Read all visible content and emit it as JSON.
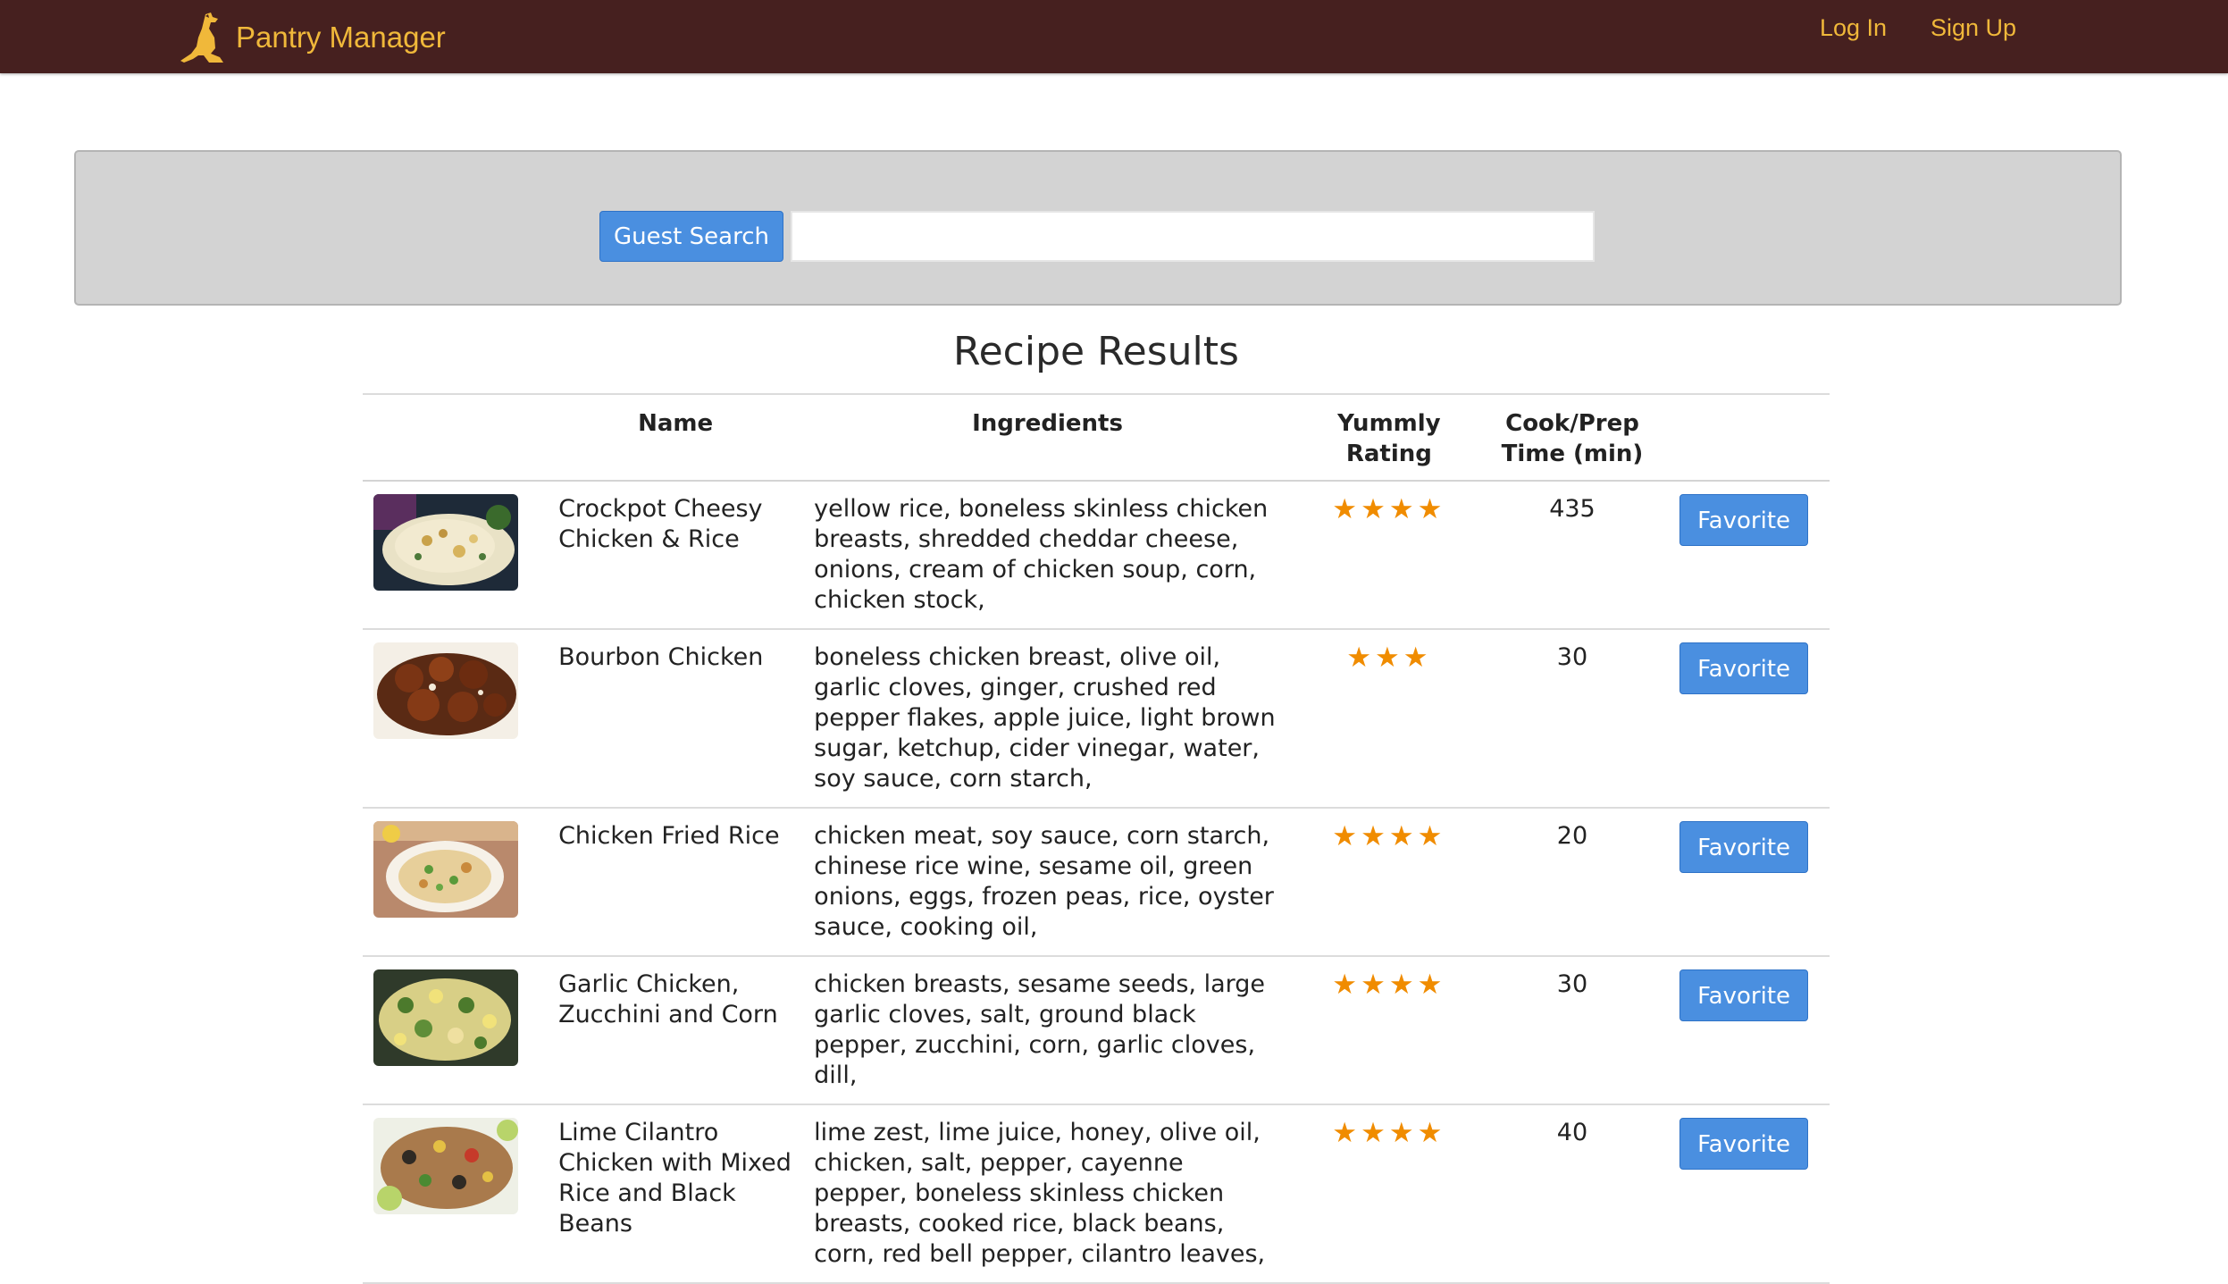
{
  "navbar": {
    "brand": "Pantry Manager",
    "brand_icon": "kangaroo-logo-icon",
    "links": {
      "login": "Log In",
      "signup": "Sign Up"
    },
    "colors": {
      "background": "#46201f",
      "text": "#f0b83a"
    }
  },
  "search": {
    "button_label": "Guest Search",
    "input_value": "",
    "input_placeholder": ""
  },
  "results": {
    "title": "Recipe Results",
    "columns": {
      "name": "Name",
      "ingredients": "Ingredients",
      "rating": "Yummly Rating",
      "time": "Cook/Prep Time (min)"
    },
    "rows": [
      {
        "name": "Crockpot Cheesy Chicken & Rice",
        "ingredients": "yellow rice, boneless skinless chicken breasts, shredded cheddar cheese, onions, cream of chicken soup, corn, chicken stock,",
        "rating": 4,
        "stars": "★★★★",
        "time": "435",
        "action": "Favorite",
        "thumbnail": "cheesy-rice-photo"
      },
      {
        "name": "Bourbon Chicken",
        "ingredients": "boneless chicken breast, olive oil, garlic cloves, ginger, crushed red pepper flakes, apple juice, light brown sugar, ketchup, cider vinegar, water, soy sauce, corn starch,",
        "rating": 3,
        "stars": "★★★",
        "time": "30",
        "action": "Favorite",
        "thumbnail": "bourbon-chicken-photo"
      },
      {
        "name": "Chicken Fried Rice",
        "ingredients": "chicken meat, soy sauce, corn starch, chinese rice wine, sesame oil, green onions, eggs, frozen peas, rice, oyster sauce, cooking oil,",
        "rating": 4,
        "stars": "★★★★",
        "time": "20",
        "action": "Favorite",
        "thumbnail": "fried-rice-photo"
      },
      {
        "name": "Garlic Chicken, Zucchini and Corn",
        "ingredients": "chicken breasts, sesame seeds, large garlic cloves, salt, ground black pepper, zucchini, corn, garlic cloves, dill,",
        "rating": 4,
        "stars": "★★★★",
        "time": "30",
        "action": "Favorite",
        "thumbnail": "zucchini-corn-photo"
      },
      {
        "name": "Lime Cilantro Chicken with Mixed Rice and Black Beans",
        "ingredients": "lime zest, lime juice, honey, olive oil, chicken, salt, pepper, cayenne pepper, boneless skinless chicken breasts, cooked rice, black beans, corn, red bell pepper, cilantro leaves,",
        "rating": 4,
        "stars": "★★★★",
        "time": "40",
        "action": "Favorite",
        "thumbnail": "lime-cilantro-rice-photo"
      }
    ]
  },
  "colors": {
    "button": "#4a8fe0",
    "star": "#f08c00",
    "panel": "#d3d3d3"
  }
}
